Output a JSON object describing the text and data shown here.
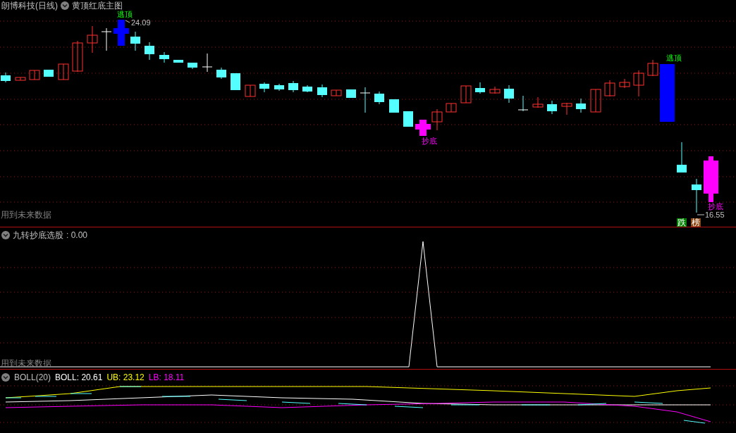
{
  "main_chart": {
    "stock_title": "朗博科技(日线)",
    "indicator_title": "黄顶红底主图",
    "markers": [
      {
        "kind": "top",
        "text": "逃顶"
      },
      {
        "kind": "bottom",
        "text": "抄底"
      },
      {
        "kind": "top",
        "text": "逃顶"
      },
      {
        "kind": "bottom",
        "text": "抄底"
      }
    ],
    "price_labels": [
      "24.09",
      "16.55"
    ],
    "badges": [
      {
        "text": "跌",
        "color": "#008000"
      },
      {
        "text": "榜",
        "color": "#8b4513"
      }
    ],
    "note": "用到未来数据"
  },
  "indicator_panel": {
    "title": "九转抄底选股",
    "value": ": 0.00",
    "note": "用到未来数据"
  },
  "boll_panel": {
    "name": "BOLL(20)",
    "values": [
      {
        "label": "BOLL: 20.61",
        "color": "#ffffff"
      },
      {
        "label": "UB: 23.12",
        "color": "#ffff00"
      },
      {
        "label": "LB: 18.11",
        "color": "#ff00ff"
      }
    ]
  }
}
